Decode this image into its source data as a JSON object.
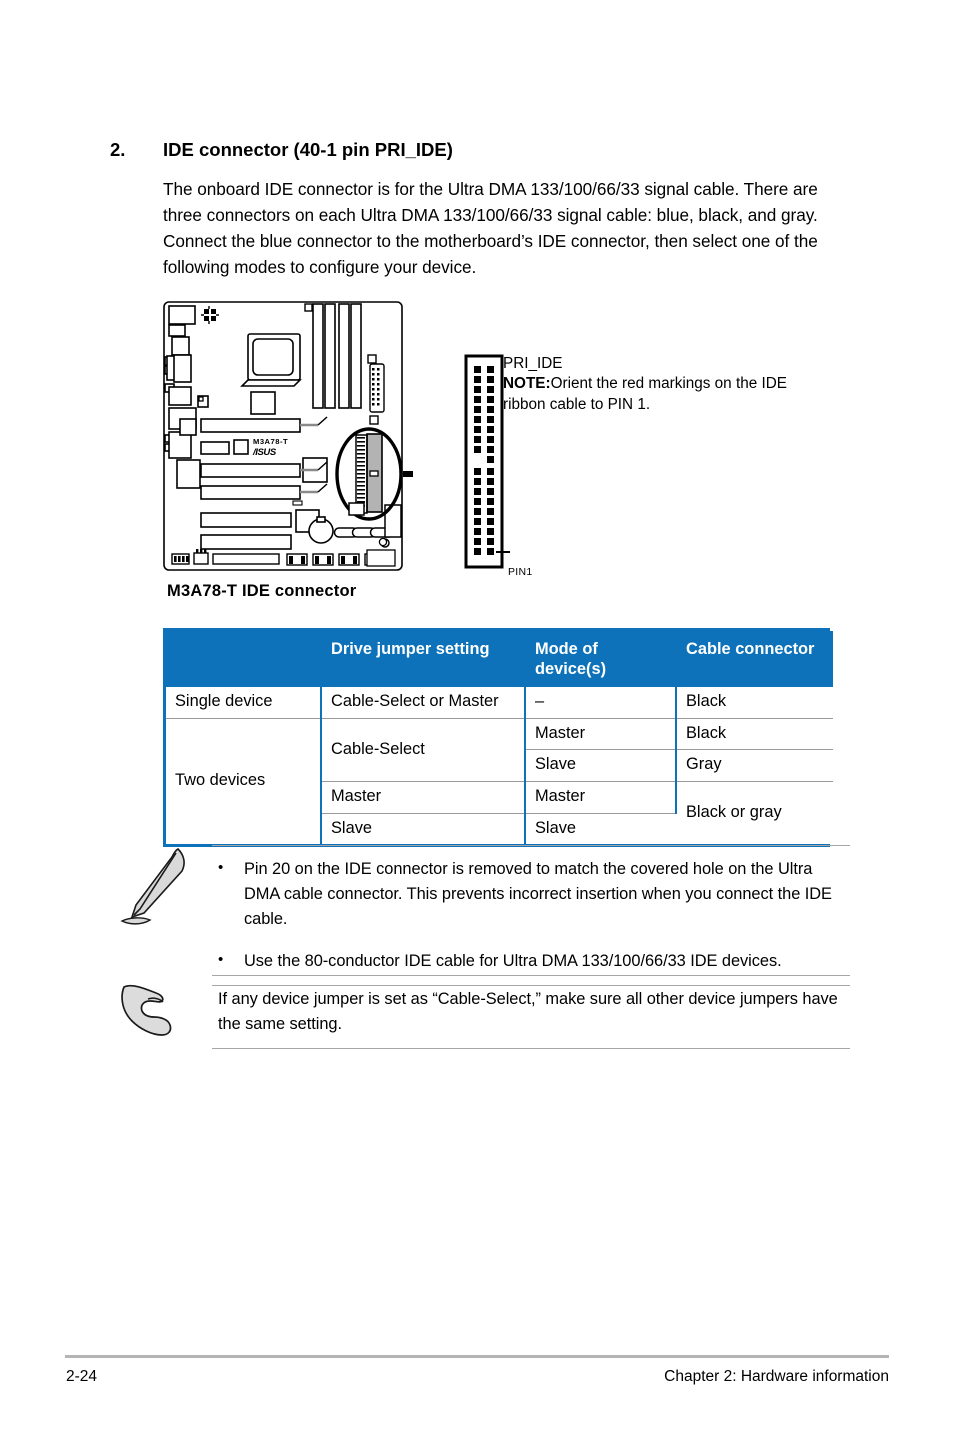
{
  "section": {
    "number": "2.",
    "title": "IDE connector (40-1 pin PRI_IDE)",
    "paragraph": "The onboard IDE connector is for the Ultra DMA 133/100/66/33 signal cable. There are three connectors on each Ultra DMA 133/100/66/33 signal cable: blue, black, and gray. Connect the blue connector to the motherboard’s IDE connector, then select one of the following modes to configure your device."
  },
  "figure": {
    "caption": "M3A78-T IDE connector",
    "board_model": "M3A78-T",
    "board_brand": "ASUS",
    "connector_name": "PRI_IDE",
    "note_label": "NOTE:",
    "note_text": "Orient the red markings on the IDE ribbon cable to PIN 1.",
    "pin1_label": "PIN1"
  },
  "table": {
    "headers": [
      "",
      "Drive jumper setting",
      "Mode of device(s)",
      "Cable connector"
    ],
    "rows": [
      {
        "device": "Single device",
        "jumper": "Cable-Select or Master",
        "mode": "–",
        "cable": "Black"
      },
      {
        "device": "Two devices",
        "jumper": "Cable-Select",
        "mode": "Master",
        "cable": "Black"
      },
      {
        "device": "",
        "jumper": "",
        "mode": "Slave",
        "cable": "Gray"
      },
      {
        "device": "",
        "jumper": "Master",
        "mode": "Master",
        "cable": "Black or gray"
      },
      {
        "device": "",
        "jumper": "Slave",
        "mode": "Slave",
        "cable": ""
      }
    ],
    "header_color": "#0d72b9"
  },
  "notes": [
    {
      "icon": "pen-note-icon",
      "bullet": "•",
      "items": [
        "Pin 20 on the IDE connector is removed to match the covered hole on the Ultra DMA cable connector. This prevents incorrect insertion when you connect the IDE cable.",
        "Use the 80-conductor IDE cable for Ultra DMA 133/100/66/33 IDE devices."
      ]
    },
    {
      "icon": "pointing-hand-icon",
      "text": "If any device jumper is set as “Cable-Select,” make sure all other device jumpers have the same setting."
    }
  ],
  "footer": {
    "page_number": "2-24",
    "chapter": "Chapter 2: Hardware information"
  }
}
